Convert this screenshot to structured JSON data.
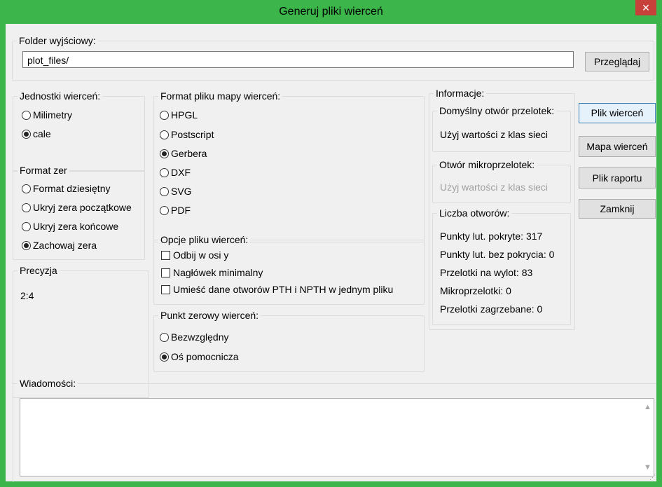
{
  "window": {
    "title": "Generuj pliki wierceń",
    "close_glyph": "✕"
  },
  "output_folder": {
    "label": "Folder wyjściowy:",
    "value": "plot_files/",
    "browse_label": "Przeglądaj"
  },
  "units": {
    "label": "Jednostki wierceń:",
    "options": [
      {
        "label": "Milimetry",
        "selected": false
      },
      {
        "label": "cale",
        "selected": true
      }
    ]
  },
  "zeros_format": {
    "label": "Format zer",
    "options": [
      {
        "label": "Format dziesiętny",
        "selected": false
      },
      {
        "label": "Ukryj zera początkowe",
        "selected": false
      },
      {
        "label": "Ukryj zera końcowe",
        "selected": false
      },
      {
        "label": "Zachowaj zera",
        "selected": true
      }
    ]
  },
  "precision": {
    "label": "Precyzja",
    "value": "2:4"
  },
  "map_format": {
    "label": "Format pliku mapy wierceń:",
    "options": [
      {
        "label": "HPGL",
        "selected": false
      },
      {
        "label": "Postscript",
        "selected": false
      },
      {
        "label": "Gerbera",
        "selected": true
      },
      {
        "label": "DXF",
        "selected": false
      },
      {
        "label": "SVG",
        "selected": false
      },
      {
        "label": "PDF",
        "selected": false
      }
    ]
  },
  "drill_options": {
    "label": "Opcje pliku wierceń:",
    "options": [
      {
        "label": "Odbij w osi y",
        "checked": false
      },
      {
        "label": "Nagłówek minimalny",
        "checked": false
      },
      {
        "label": "Umieść dane otworów PTH i NPTH w jednym pliku",
        "checked": false
      }
    ]
  },
  "origin": {
    "label": "Punkt zerowy wierceń:",
    "options": [
      {
        "label": "Bezwzględny",
        "selected": false
      },
      {
        "label": "Oś pomocnicza",
        "selected": true
      }
    ]
  },
  "info": {
    "label": "Informacje:",
    "default_via": {
      "label": "Domyślny otwór przelotek:",
      "value": "Użyj wartości z klas sieci"
    },
    "micro_via": {
      "label": "Otwór mikroprzelotek:",
      "value": "Użyj wartości z klas sieci"
    },
    "hole_count": {
      "label": "Liczba otworów:",
      "lines": [
        "Punkty lut. pokryte: 317",
        "Punkty lut. bez pokrycia: 0",
        "Przelotki na wylot: 83",
        "Mikroprzelotki: 0",
        "Przelotki zagrzebane: 0"
      ]
    }
  },
  "buttons": {
    "drill_file": "Plik wierceń",
    "drill_map": "Mapa wierceń",
    "report_file": "Plik raportu",
    "close": "Zamknij"
  },
  "messages": {
    "label": "Wiadomości:",
    "value": ""
  },
  "icons": {
    "scroll_up": "▲",
    "scroll_down": "▼",
    "grip": "⋰"
  }
}
